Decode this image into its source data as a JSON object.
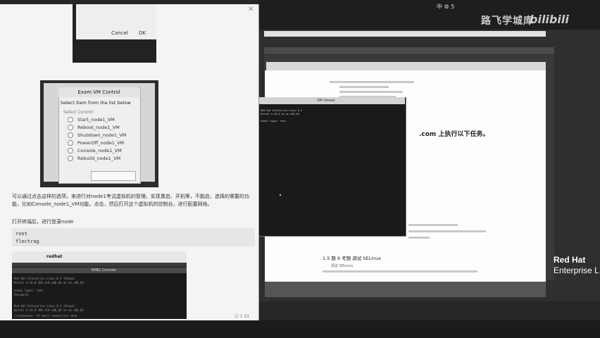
{
  "watermark": {
    "text": "路飞学城库",
    "logo": "bilibili"
  },
  "clock": "中 ⚙ 5",
  "brand": {
    "line1": "Red Hat",
    "line2": "Enterprise L"
  },
  "dialog1": {
    "cancel": "Cancel",
    "ok": "OK"
  },
  "vm_control": {
    "title": "Exam VM Control",
    "subtitle": "Select item from the list below",
    "header": "Select   Control",
    "items": [
      "Start_node1_VM",
      "Reboot_node1_VM",
      "Shutdown_node1_VM",
      "PowerOff_node1_VM",
      "Console_node1_VM",
      "Rebuild_node1_VM"
    ]
  },
  "doc": {
    "para1": "可以通过点击这样的选项，来进行对node1考试虚拟机的管理，实现重启、开机等，不能启，选择的需要的功能，比如Console_node1_VM功能，点击，然后打开这个虚拟机的控制台，进行配置网络。",
    "para2": "打开终端后，进行登录node",
    "code_line1": "root",
    "code_line2": "flectrag",
    "shot_brand": "redhat",
    "shot_title": "RHEL Console",
    "term_lines": [
      "Red Hat Enterprise Linux 8.4 (Ootpa)",
      "Kernel 4.18.0-305.el8.x86_64 on an x86_64",
      "node1 login: root",
      "Password:",
      "",
      "Red Hat Enterprise Linux 8.4 (Ootpa)",
      "Kernel 4.18.0-305.el8.x86_64 on an x86_64",
      "[root@node1 ~]# nmcli connection show"
    ],
    "page_count": "1/ 1 01"
  },
  "guest": {
    "task_heading": ".com 上执行以下任务。",
    "selinux": "1.5 题 6 考题 调试 SELinux",
    "selinux_sub": "调试 SELinux",
    "terminal_title": "VM Viewer",
    "terminal_lines": [
      "Red Hat Enterprise Linux 8.4",
      "Kernel 4.18.0 on an x86_64",
      "",
      "node1 login: root"
    ]
  }
}
